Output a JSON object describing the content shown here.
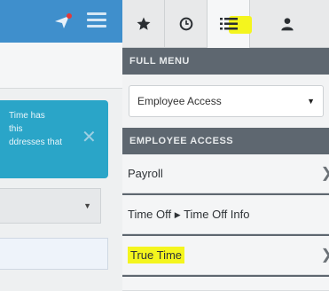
{
  "background_app": {
    "alert_lines": [
      "Time has",
      "this",
      "ddresses that"
    ],
    "alert_close": "✕"
  },
  "tabs": [
    {
      "name": "favorites",
      "icon": "star-icon"
    },
    {
      "name": "recent",
      "icon": "clock-icon"
    },
    {
      "name": "full-menu",
      "icon": "list-icon",
      "active": true,
      "highlight": "#f4f51e"
    },
    {
      "name": "profile",
      "icon": "user-icon"
    }
  ],
  "full_menu": {
    "header": "FULL MENU",
    "select_value": "Employee Access"
  },
  "employee_access": {
    "header": "EMPLOYEE ACCESS",
    "items": [
      {
        "label": "Payroll"
      },
      {
        "label_part1": "Time Off",
        "separator": "▶",
        "label_part2": "Time Off Info"
      },
      {
        "label": "True Time",
        "highlight": "#f4f51e"
      }
    ]
  },
  "colors": {
    "panel_header": "#5e6770",
    "brand_blue": "#3f8fcc",
    "alert": "#2aa5c8",
    "highlight": "#f4f51e"
  }
}
